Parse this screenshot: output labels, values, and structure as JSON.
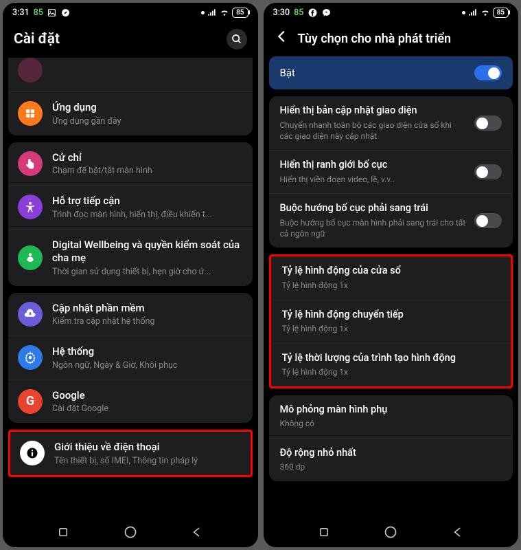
{
  "left": {
    "status": {
      "time": "3:31",
      "num": "85",
      "battery": "85"
    },
    "title": "Cài đặt",
    "rows": [
      {
        "title": "Ứng dụng",
        "sub": "Ứng dụng gần đây",
        "color": "#ff7a1a"
      },
      {
        "title": "Cử chỉ",
        "sub": "Chạm để bật/tắt màn hình",
        "color": "#d63a7a"
      },
      {
        "title": "Hỗ trợ tiếp cận",
        "sub": "Trình đọc màn hình, hiển thị, điều khiển t...",
        "color": "#8b3fd9"
      },
      {
        "title": "Digital Wellbeing và quyền kiểm soát của cha mẹ",
        "sub": "Thời gian sử dụng thiết bị, hẹn giờ cho ứ...",
        "color": "#1db954"
      },
      {
        "title": "Cập nhật phần mềm",
        "sub": "Kiểm tra cập nhật hệ thống",
        "color": "#6b5ed9"
      },
      {
        "title": "Hệ thống",
        "sub": "Ngôn ngữ, Ngày & Giờ, Khôi phục",
        "color": "#2d7ae8"
      },
      {
        "title": "Google",
        "sub": "Cài đặt Google",
        "color": "#e8432d"
      },
      {
        "title": "Giới thiệu về điện thoại",
        "sub": "Tên thiết bị, số IMEI, Thông tin pháp lý",
        "color": "#ffffff"
      }
    ]
  },
  "right": {
    "status": {
      "time": "3:30",
      "num": "85",
      "battery": "85"
    },
    "title": "Tùy chọn cho nhà phát triển",
    "enable_label": "Bật",
    "rows": [
      {
        "title": "Hiển thị bản cập nhật giao diện",
        "sub": "Chuyển nhanh toàn bộ các giao diện cửa sổ khi các giao diện này cập nhật",
        "toggle": false
      },
      {
        "title": "Hiển thị ranh giới bố cục",
        "sub": "Hiển thị viền đoạn video, lề, v.v..",
        "toggle": false
      },
      {
        "title": "Buộc hướng bố cục phải sang trái",
        "sub": "Buộc hướng bố cục màn hình phải sang trái cho tất cả ngôn ngữ",
        "toggle": false
      },
      {
        "title": "Tỷ lệ hình động của cửa sổ",
        "sub": "Tỷ lệ hình động 1x"
      },
      {
        "title": "Tỷ lệ hình động chuyển tiếp",
        "sub": "Tỷ lệ hình động 1x"
      },
      {
        "title": "Tỷ lệ thời lượng của trình tạo hình động",
        "sub": "Tỷ lệ hình động 1x"
      },
      {
        "title": "Mô phỏng màn hình phụ",
        "sub": "Không có"
      },
      {
        "title": "Độ rộng nhỏ nhất",
        "sub": "360 dp"
      }
    ]
  }
}
